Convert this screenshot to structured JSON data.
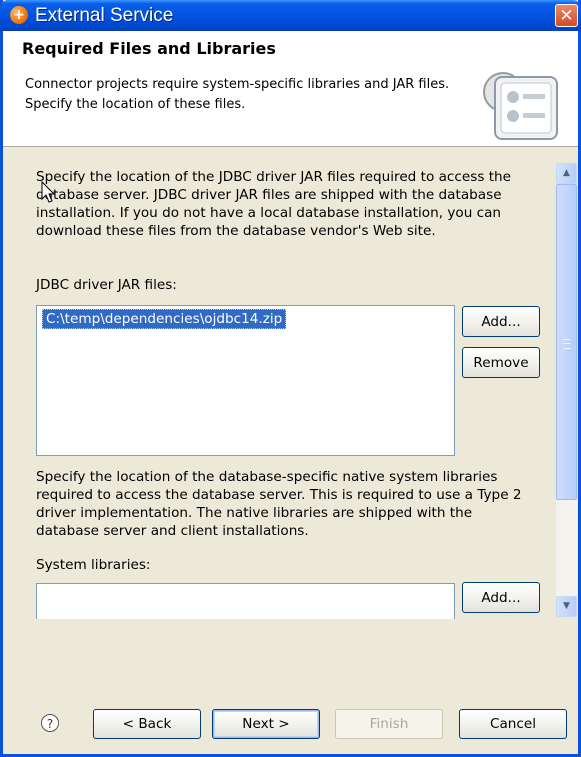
{
  "window": {
    "title": "External Service",
    "app_icon": "plus-circle-icon",
    "close_icon": "close-icon"
  },
  "header": {
    "title": "Required Files and Libraries",
    "description": "Connector projects require system-specific libraries and JAR files. Specify the location of these files.",
    "graphic_icon": "settings-list-icon"
  },
  "body": {
    "jdbc_instructions": "Specify the location of the JDBC driver JAR files required to access the database server. JDBC driver JAR files are shipped with the database installation. If you do not have a local database installation, you can download these files from the database vendor's Web site.",
    "jdbc_label": "JDBC driver JAR files:",
    "jdbc_files": [
      "C:\\temp\\dependencies\\ojdbc14.zip"
    ],
    "jdbc_add_label": "Add...",
    "jdbc_remove_label": "Remove",
    "native_instructions": "Specify the location of the database-specific native system libraries required to access the database server. This is required to use a Type 2 driver implementation. The native libraries are shipped with the database server and client installations.",
    "system_label": "System libraries:",
    "system_add_label": "Add..."
  },
  "footer": {
    "help_icon": "help-icon",
    "back_label": "< Back",
    "next_label": "Next >",
    "finish_label": "Finish",
    "cancel_label": "Cancel"
  },
  "colors": {
    "titlebar": "#0154e3",
    "selection": "#316ac5",
    "dialog_background": "#ece9d8"
  }
}
